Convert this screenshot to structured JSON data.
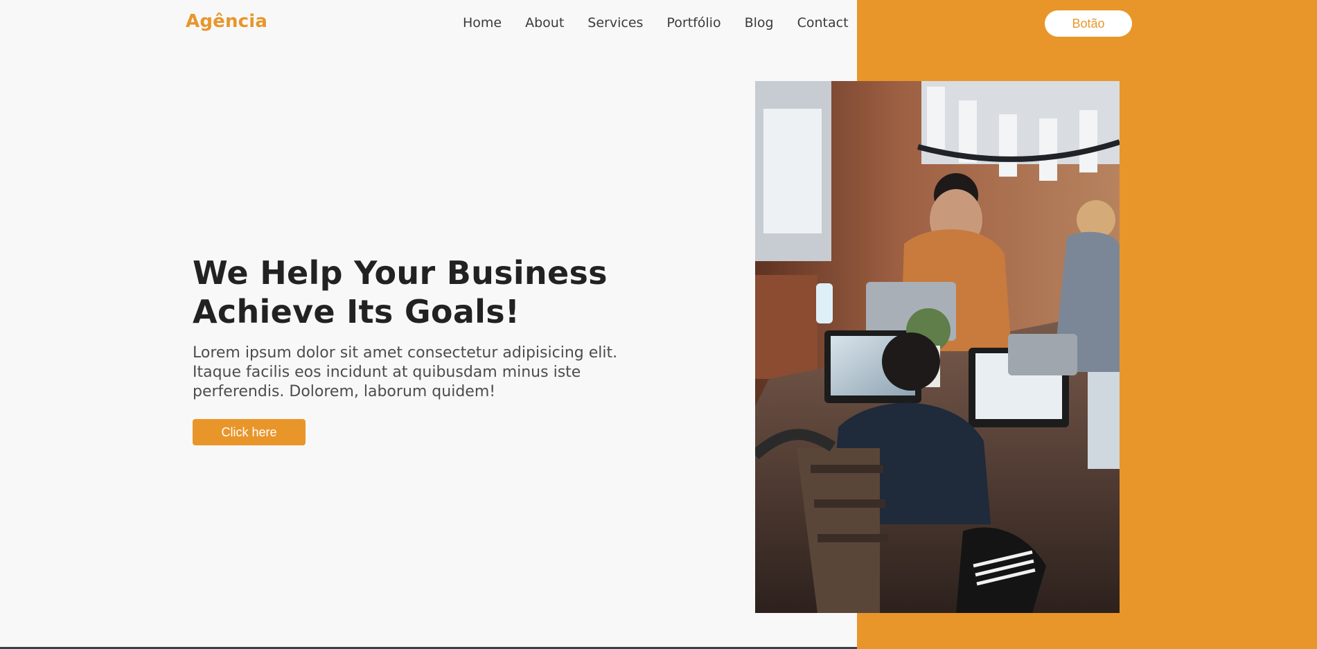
{
  "brand": {
    "name": "Agência",
    "accent_color": "#e8962a"
  },
  "nav": {
    "items": [
      {
        "label": "Home"
      },
      {
        "label": "About"
      },
      {
        "label": "Services"
      },
      {
        "label": "Portfólio"
      },
      {
        "label": "Blog"
      },
      {
        "label": "Contact"
      }
    ]
  },
  "header": {
    "button_label": "Botão"
  },
  "hero": {
    "title_line_1": "We Help Your Business",
    "title_line_2": "Achieve Its Goals!",
    "description_line_1": "Lorem ipsum dolor sit amet consectetur adipisicing elit.",
    "description_line_2": "Itaque facilis eos incidunt at quibusdam minus iste",
    "description_line_3": "perferendis. Dolorem, laborum quidem!",
    "button_label": "Click here",
    "image_icon": "team-meeting-photo"
  },
  "colors": {
    "background": "#f8f8f8",
    "orange": "#e8962a",
    "white": "#ffffff",
    "dark_text": "#222222"
  }
}
